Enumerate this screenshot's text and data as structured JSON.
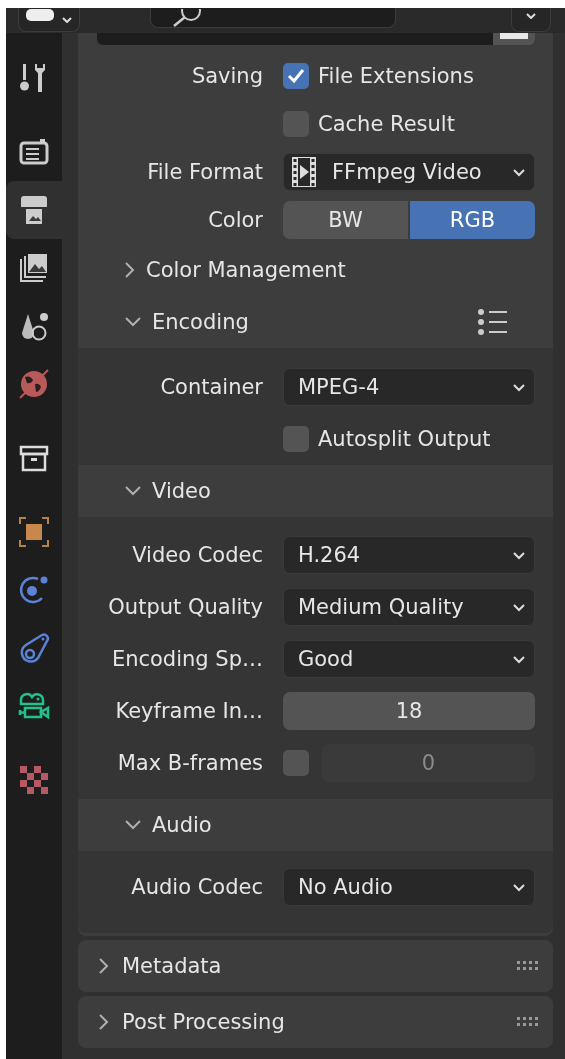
{
  "sidebar_groups": [
    {
      "tabs": [
        {
          "selected": false
        }
      ]
    },
    {
      "tabs": [
        {
          "selected": false
        },
        {
          "selected": true
        },
        {
          "selected": false
        },
        {
          "selected": false
        },
        {
          "selected": false
        }
      ]
    },
    {
      "tabs": [
        {
          "selected": false
        }
      ]
    },
    {
      "tabs": [
        {
          "selected": false
        },
        {
          "selected": false
        },
        {
          "selected": false
        },
        {
          "selected": false
        }
      ]
    },
    {
      "tabs": [
        {
          "selected": false
        }
      ]
    }
  ],
  "output_panel": {
    "rows": [
      {
        "kind": "checkbox",
        "label": "Saving",
        "text": "File Extensions",
        "checked": true
      },
      {
        "kind": "checkbox",
        "text": "Cache Result",
        "checked": false
      },
      {
        "kind": "file_format",
        "label": "File Format",
        "value": "FFmpeg Video"
      },
      {
        "kind": "enum",
        "label": "Color",
        "options": [
          {
            "label": "BW",
            "selected": false
          },
          {
            "label": "RGB",
            "selected": true
          }
        ]
      }
    ],
    "subpanels": [
      {
        "title": "Color Management",
        "expanded": false
      },
      {
        "title": "Encoding",
        "expanded": true,
        "rows": [
          {
            "kind": "dropdown",
            "label": "Container",
            "value": "MPEG-4"
          },
          {
            "kind": "checkbox",
            "text": "Autosplit Output",
            "checked": false
          }
        ],
        "subpanels": [
          {
            "title": "Video",
            "expanded": true,
            "rows": [
              {
                "kind": "dropdown",
                "label": "Video Codec",
                "value": "H.264"
              },
              {
                "kind": "dropdown",
                "label": "Output Quality",
                "value": "Medium Quality"
              },
              {
                "kind": "dropdown",
                "label": "Encoding Sp…",
                "value": "Good"
              },
              {
                "kind": "number",
                "label": "Keyframe In…",
                "value": "18"
              },
              {
                "kind": "toggle_number",
                "label": "Max B-frames",
                "checked": false,
                "value": "0",
                "disabled": true
              }
            ]
          },
          {
            "title": "Audio",
            "expanded": true,
            "rows": [
              {
                "kind": "dropdown",
                "label": "Audio Codec",
                "value": "No Audio"
              }
            ]
          }
        ]
      }
    ]
  },
  "panels": [
    {
      "title": "Metadata",
      "expanded": false
    },
    {
      "title": "Post Processing",
      "expanded": false
    }
  ]
}
